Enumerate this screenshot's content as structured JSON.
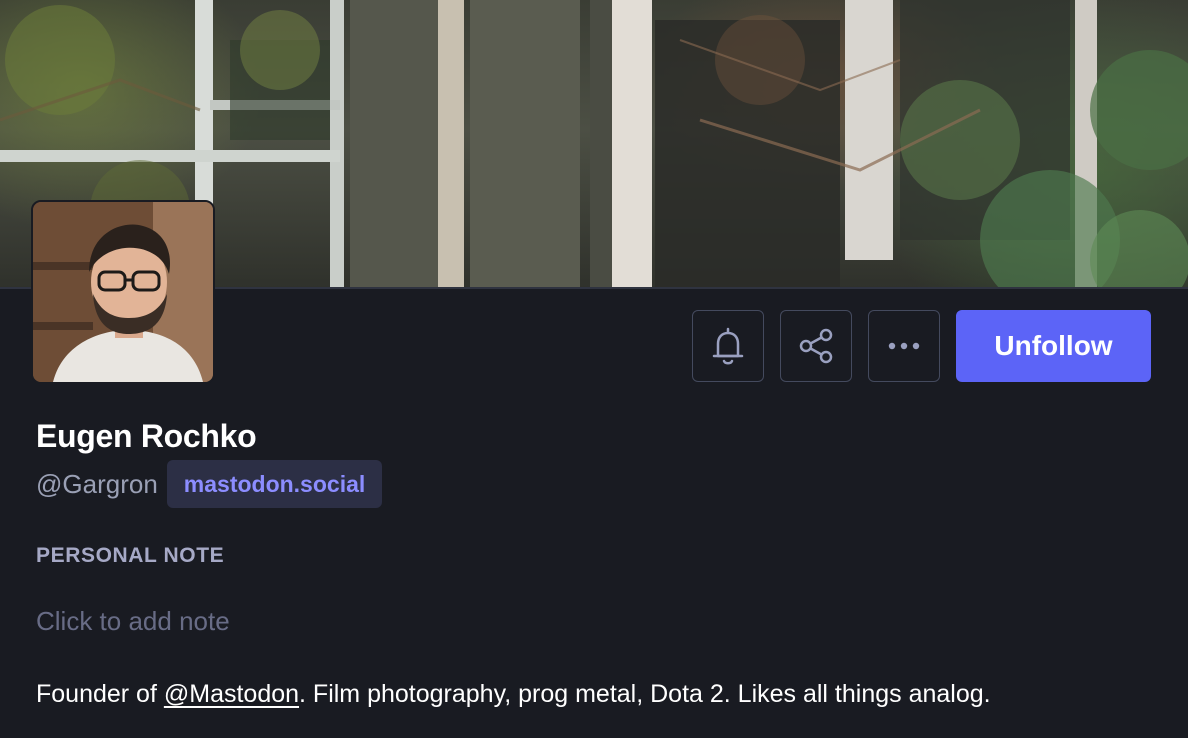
{
  "header": {
    "banner_icon": "header-photo",
    "avatar_icon": "avatar-photo"
  },
  "actions": {
    "notify_icon": "bell-icon",
    "share_icon": "share-icon",
    "more_icon": "ellipsis-icon",
    "unfollow_label": "Unfollow"
  },
  "profile": {
    "display_name": "Eugen Rochko",
    "handle": "@Gargron",
    "domain": "mastodon.social"
  },
  "personal_note": {
    "label": "PERSONAL NOTE",
    "placeholder": "Click to add note"
  },
  "bio": {
    "prefix": "Founder of ",
    "mention": "@Mastodon",
    "suffix": ". Film photography, prog metal, Dota 2. Likes all things analog."
  },
  "colors": {
    "background": "#191b22",
    "accent": "#5c64f7",
    "badge_bg": "#2c2f45",
    "badge_text": "#8c8dff"
  }
}
